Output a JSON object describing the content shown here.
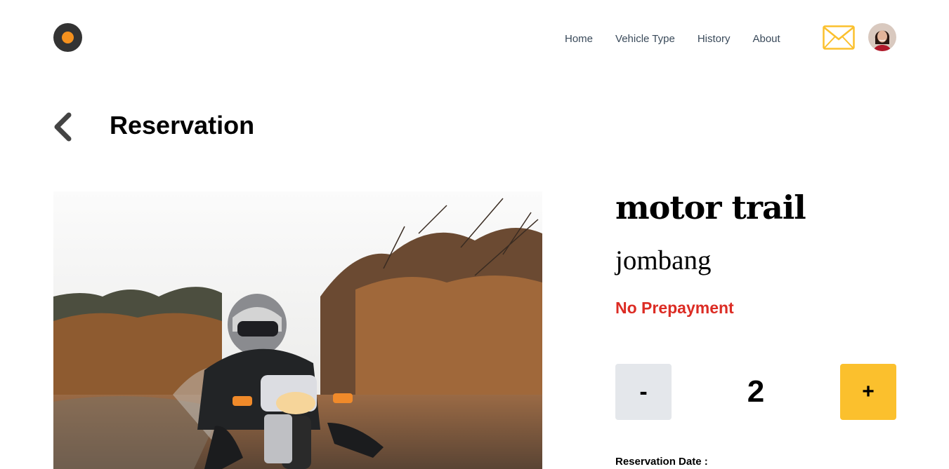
{
  "header": {
    "nav": [
      {
        "label": "Home"
      },
      {
        "label": "Vehicle Type"
      },
      {
        "label": "History"
      },
      {
        "label": "About"
      }
    ],
    "icons": {
      "logo": "logo-icon",
      "mail": "mail-icon",
      "avatar": "user-avatar"
    },
    "colors": {
      "accent": "#fbc02d",
      "logo_dot": "#f5911e",
      "mail": "#fbc02d"
    }
  },
  "page": {
    "back_icon": "chevron-left-icon",
    "title": "Reservation"
  },
  "vehicle": {
    "name": "motor trail",
    "location": "jombang",
    "prepayment": "No Prepayment",
    "prepayment_color": "#dc2c24"
  },
  "quantity": {
    "minus_label": "-",
    "value": "2",
    "plus_label": "+"
  },
  "reservation": {
    "date_label": "Reservation Date :"
  }
}
